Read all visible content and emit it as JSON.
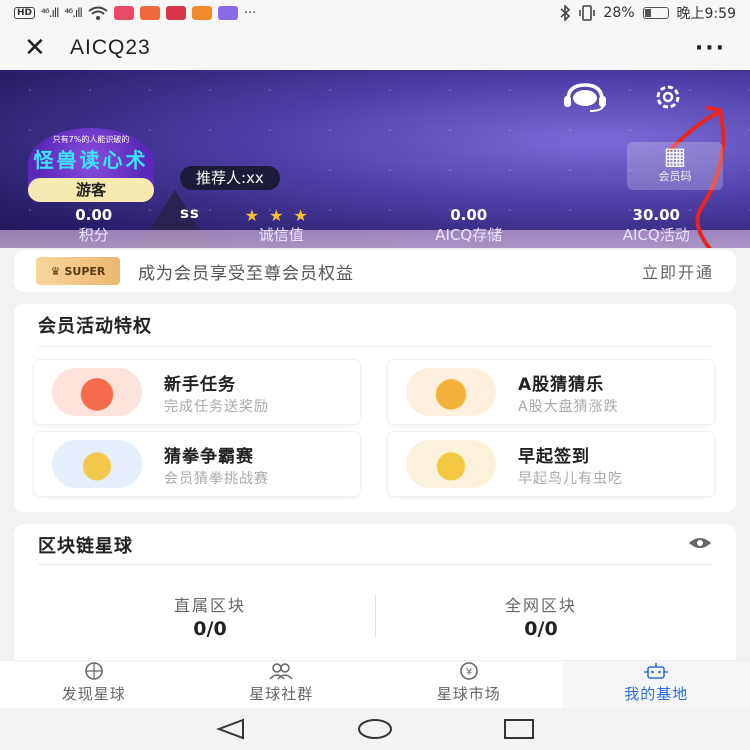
{
  "status_bar": {
    "left_badge": "HD",
    "signal1": "⁴⁶.ıll",
    "signal2": "⁴⁶.ıll",
    "more": "···",
    "battery_percent": "28%",
    "time": "晚上9:59"
  },
  "titlebar": {
    "title": "AICQ23",
    "more": "···"
  },
  "profile": {
    "avatar_small_text": "只有7%的人能识破的",
    "avatar_big_text": "怪兽读心术",
    "role_badge": "游客",
    "username": "ss",
    "referrer": "推荐人:xx",
    "qrcode_label": "会员码"
  },
  "stats": [
    {
      "value": "0.00",
      "label": "积分"
    },
    {
      "value": "",
      "label": "诚信值",
      "stars": 3
    },
    {
      "value": "0.00",
      "label": "AICQ存储"
    },
    {
      "value": "30.00",
      "label": "AICQ活动"
    }
  ],
  "super_bar": {
    "logo": "SUPER",
    "text": "成为会员享受至尊会员权益",
    "link": "立即开通"
  },
  "privileges": {
    "title": "会员活动特权",
    "items": [
      {
        "name": "新手任务",
        "desc": "完成任务送奖励"
      },
      {
        "name": "A股猜猜乐",
        "desc": "A股大盘猜涨跌"
      },
      {
        "name": "猜拳争霸赛",
        "desc": "会员猜拳挑战赛"
      },
      {
        "name": "早起签到",
        "desc": "早起鸟儿有虫吃"
      }
    ]
  },
  "planet": {
    "title": "区块链星球",
    "direct_label": "直属区块",
    "direct_value": "0/0",
    "global_label": "全网区块",
    "global_value": "0/0"
  },
  "bottom_nav": [
    {
      "label": "发现星球",
      "icon": "compass-icon",
      "active": false
    },
    {
      "label": "星球社群",
      "icon": "people-icon",
      "active": false
    },
    {
      "label": "星球市场",
      "icon": "yen-icon",
      "active": false
    },
    {
      "label": "我的基地",
      "icon": "robot-icon",
      "active": true
    }
  ],
  "colors": {
    "accent": "#2f6fe0",
    "star": "#f6c531",
    "annotation": "#e8261f"
  }
}
